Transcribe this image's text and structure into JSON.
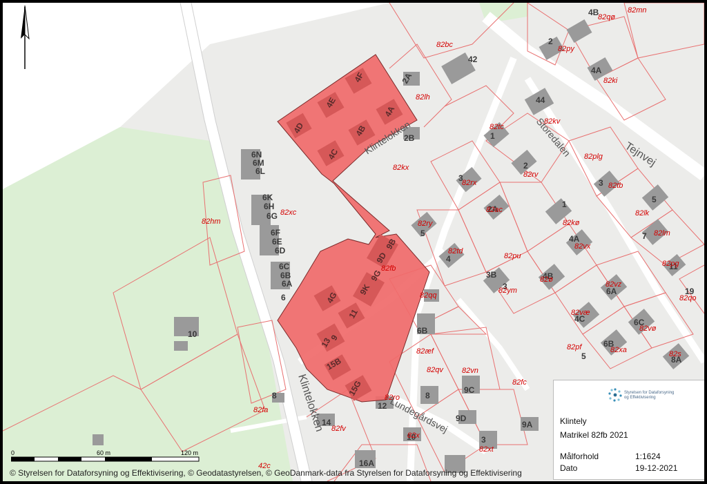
{
  "map": {
    "north_arrow": "north-arrow-icon",
    "colors": {
      "highlight": "#f06a6a",
      "parcel_line": "#e87070",
      "building": "#9a9a9a",
      "green": "#dcefd4",
      "road": "#ffffff"
    },
    "roads": {
      "klintelokken_top": "Klintelokken",
      "klintelokken_bottom": "Klintelokken",
      "storedalen": "Storedalen",
      "tejnvej": "Tejnvej",
      "lundegaardsvej": "Lundegårdsvej"
    },
    "highlight_labels": [
      "4F",
      "4E",
      "4A",
      "4D",
      "4B",
      "4C",
      "9D",
      "9B",
      "9K",
      "9G",
      "4G",
      "11",
      "13",
      "9",
      "15B",
      "15G"
    ],
    "house_numbers": [
      "4B",
      "2",
      "4A",
      "42",
      "44",
      "2A",
      "2B",
      "1",
      "6N",
      "6M",
      "6L",
      "6K",
      "6H",
      "6G",
      "6F",
      "6E",
      "6D",
      "6C",
      "6B",
      "6A",
      "6",
      "2",
      "3",
      "3",
      "5",
      "2A",
      "1",
      "5",
      "4",
      "7",
      "4A",
      "11",
      "3B",
      "3",
      "4B",
      "4C",
      "6A",
      "6C",
      "19",
      "6B",
      "6B",
      "5",
      "8A",
      "10",
      "8",
      "14",
      "12",
      "8",
      "9C",
      "9D",
      "9A",
      "10",
      "3",
      "16A"
    ],
    "cadastral_labels": [
      "82mn",
      "82qø",
      "82bc",
      "82py",
      "82ki",
      "82lh",
      "82tc",
      "82kv",
      "82kx",
      "82plg",
      "82rx",
      "82rv",
      "82tb",
      "82xc",
      "82hm",
      "82ry",
      "82ac",
      "82kø",
      "82lk",
      "82lm",
      "82td",
      "82pu",
      "82vx",
      "82pg",
      "82fb",
      "82qq",
      "82ø",
      "82ym",
      "82vz",
      "82qo",
      "82væ",
      "82vø",
      "82æf",
      "82pf",
      "82xa",
      "82s",
      "82vn",
      "82ro",
      "82qv",
      "82fc",
      "82fa",
      "82fv",
      "82x",
      "82xt",
      "42c",
      "82fv"
    ]
  },
  "scale_bar": {
    "labels": [
      "0",
      "60 m",
      "120 m"
    ]
  },
  "attribution": "© Styrelsen for Dataforsyning og Effektivisering, © Geodatastyrelsen, © GeoDanmark-data fra Styrelsen for Dataforsyning og Effektivisering",
  "infobox": {
    "logo_text": "Styrelsen for Dataforsyning og Effektivisering",
    "title": "Klintely",
    "subtitle": "Matrikel 82fb 2021",
    "scale_label": "Målforhold",
    "scale_value": "1:1624",
    "date_label": "Dato",
    "date_value": "19-12-2021"
  }
}
